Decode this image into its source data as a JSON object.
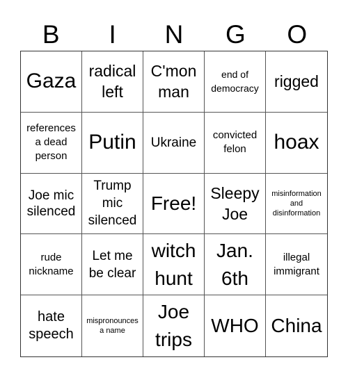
{
  "header": {
    "letters": [
      "B",
      "I",
      "N",
      "G",
      "O"
    ]
  },
  "board": {
    "cells": [
      "Gaza",
      "radical left",
      "C'mon man",
      "end of democracy",
      "rigged",
      "references a dead person",
      "Putin",
      "Ukraine",
      "convicted felon",
      "hoax",
      "Joe mic silenced",
      "Trump mic silenced",
      "Free!",
      "Sleepy Joe",
      "misinformation and disinformation",
      "rude nickname",
      "Let me be clear",
      "witch hunt",
      "Jan. 6th",
      "illegal immigrant",
      "hate speech",
      "mispronounces a name",
      "Joe trips",
      "WHO",
      "China"
    ],
    "free_space": "Free!"
  }
}
